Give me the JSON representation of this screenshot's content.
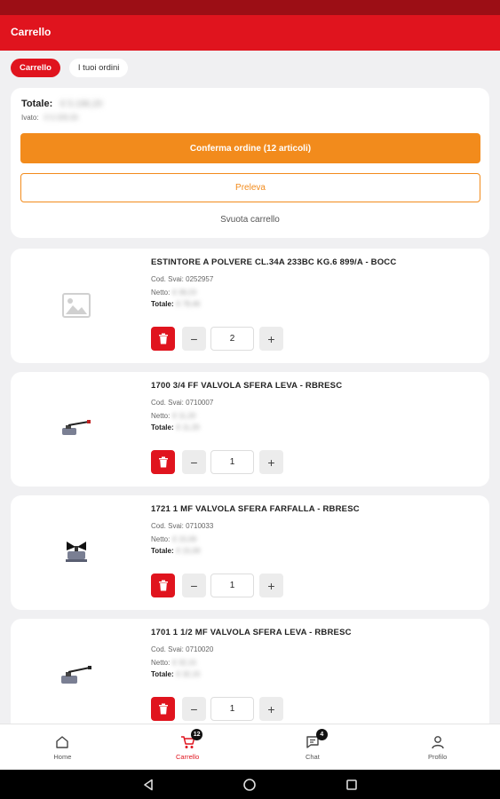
{
  "app": {
    "title": "Carrello"
  },
  "tabs": [
    {
      "label": "Carrello",
      "active": true
    },
    {
      "label": "I tuoi ordini",
      "active": false
    }
  ],
  "summary": {
    "total_label": "Totale:",
    "total_value": "€ 5.196,20",
    "ivato_label": "Ivato:",
    "ivato_value": "€ 6.339,36",
    "confirm_label": "Conferma ordine (12 articoli)",
    "preleva_label": "Preleva",
    "empty_label": "Svuota carrello"
  },
  "products": [
    {
      "name": "ESTINTORE A POLVERE CL.34A 233BC KG.6 899/A - BOCC",
      "code": "Cod. Svai: 0252957",
      "netto_label": "Netto:",
      "netto_value": "€ 39,23",
      "totale_label": "Totale:",
      "totale_value": "€ 78,46",
      "qty": "2",
      "image": "image-placeholder-icon"
    },
    {
      "name": "1700 3/4 FF VALVOLA SFERA LEVA - RBRESC",
      "code": "Cod. Svai: 0710007",
      "netto_label": "Netto:",
      "netto_value": "€ 11,20",
      "totale_label": "Totale:",
      "totale_value": "€ 11,20",
      "qty": "1",
      "image": "ball-valve-lever-icon"
    },
    {
      "name": "1721 1 MF VALVOLA SFERA FARFALLA - RBRESC",
      "code": "Cod. Svai: 0710033",
      "netto_label": "Netto:",
      "netto_value": "€ 15,09",
      "totale_label": "Totale:",
      "totale_value": "€ 15,09",
      "qty": "1",
      "image": "ball-valve-butterfly-icon"
    },
    {
      "name": "1701 1 1/2 MF VALVOLA SFERA LEVA - RBRESC",
      "code": "Cod. Svai: 0710020",
      "netto_label": "Netto:",
      "netto_value": "€ 32,15",
      "totale_label": "Totale:",
      "totale_value": "€ 32,15",
      "qty": "1",
      "image": "ball-valve-lever-icon"
    }
  ],
  "nav": [
    {
      "label": "Home",
      "icon": "home-icon",
      "badge": ""
    },
    {
      "label": "Carrello",
      "icon": "cart-icon",
      "badge": "12",
      "active": true
    },
    {
      "label": "Chat",
      "icon": "chat-icon",
      "badge": "4"
    },
    {
      "label": "Profilo",
      "icon": "profile-icon",
      "badge": ""
    }
  ],
  "colors": {
    "brand_red": "#e0141e",
    "status_red": "#9c0e15",
    "accent_orange": "#f28b1c"
  }
}
